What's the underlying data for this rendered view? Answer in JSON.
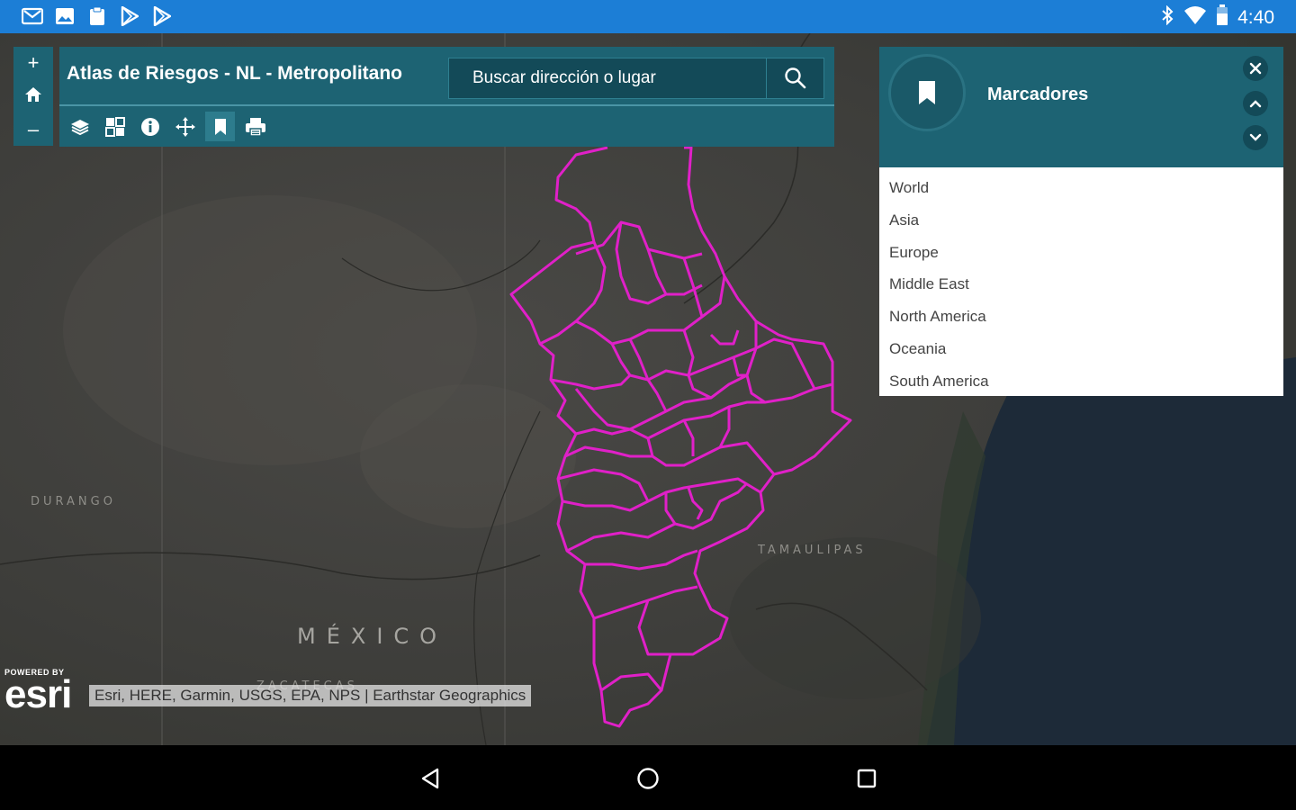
{
  "status_bar": {
    "time": "4:40",
    "notification_icons": [
      "gmail-icon",
      "image-icon",
      "clipboard-icon",
      "play-store-icon",
      "play-store-icon"
    ],
    "system_icons": [
      "bluetooth-icon",
      "wifi-icon",
      "battery-icon"
    ],
    "background": "#1c7ed6"
  },
  "map": {
    "labels": {
      "mexico": "MÉXICO",
      "durango": "DURANGO",
      "tamaulipas": "TAMAULIPAS",
      "zacatecas": "ZACATECAS"
    },
    "boundary_color": "#e020c8"
  },
  "zoom": {
    "zoom_in": "+",
    "zoom_out": "–"
  },
  "header": {
    "title": "Atlas de Riesgos - NL - Metropolitano",
    "search_placeholder": "Buscar dirección o lugar",
    "tools": [
      "layers-icon",
      "basemap-icon",
      "info-icon",
      "move-icon",
      "bookmark-icon",
      "print-icon"
    ],
    "active_tool": "bookmark-icon",
    "background": "#1d6373"
  },
  "bookmarks": {
    "title": "Marcadores",
    "items": [
      "World",
      "Asia",
      "Europe",
      "Middle East",
      "North America",
      "Oceania",
      "South America"
    ]
  },
  "attribution": {
    "powered_by": "POWERED BY",
    "logo": "esri",
    "text": "Esri, HERE, Garmin, USGS, EPA, NPS | Earthstar Geographics"
  },
  "nav_bar": {
    "buttons": [
      "back-icon",
      "home-icon",
      "recents-icon"
    ]
  }
}
